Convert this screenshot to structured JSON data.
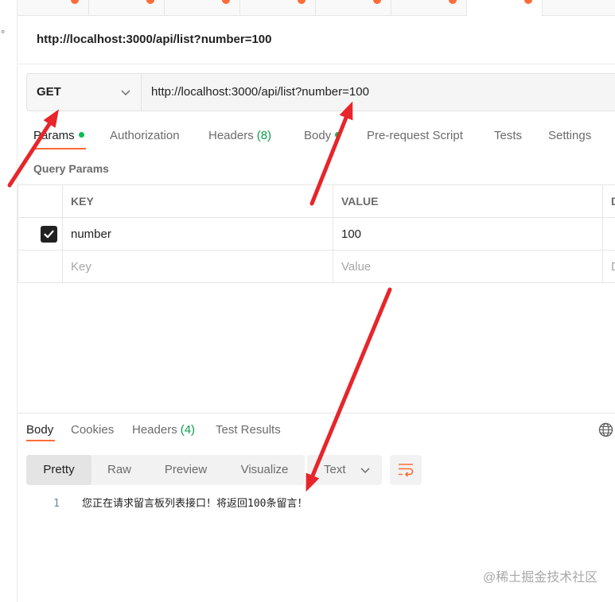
{
  "colors": {
    "accent": "#ff6c37",
    "success": "#0cbb52",
    "text": "#212121",
    "muted": "#6b6b6b",
    "placeholder": "#a6a6a6",
    "annotation_arrow": "#e8252a"
  },
  "sidebar": {
    "glyph": "°"
  },
  "open_tabs": [
    {
      "unsaved": true,
      "active": false
    },
    {
      "unsaved": true,
      "active": false
    },
    {
      "unsaved": true,
      "active": false
    },
    {
      "unsaved": true,
      "active": false
    },
    {
      "unsaved": true,
      "active": false
    },
    {
      "unsaved": true,
      "active": false
    },
    {
      "unsaved": true,
      "active": true
    }
  ],
  "request": {
    "title": "http://localhost:3000/api/list?number=100",
    "method": "GET",
    "url": "http://localhost:3000/api/list?number=100"
  },
  "request_tabs": [
    {
      "label": "Params",
      "active": true,
      "has_content_dot": true
    },
    {
      "label": "Authorization"
    },
    {
      "label": "Headers",
      "count": "(8)"
    },
    {
      "label": "Body",
      "has_content_dot": true
    },
    {
      "label": "Pre-request Script"
    },
    {
      "label": "Tests"
    },
    {
      "label": "Settings"
    }
  ],
  "query_params": {
    "title": "Query Params",
    "columns": {
      "key": "KEY",
      "value": "VALUE",
      "description": "D"
    },
    "rows": [
      {
        "enabled": true,
        "key": "number",
        "value": "100",
        "description": ""
      }
    ],
    "new_row": {
      "key": "Key",
      "value": "Value",
      "description": "D"
    }
  },
  "response": {
    "tabs": [
      {
        "label": "Body",
        "active": true
      },
      {
        "label": "Cookies"
      },
      {
        "label": "Headers",
        "count": "(4)"
      },
      {
        "label": "Test Results"
      }
    ],
    "view_modes": [
      {
        "label": "Pretty",
        "active": true
      },
      {
        "label": "Raw"
      },
      {
        "label": "Preview"
      },
      {
        "label": "Visualize"
      }
    ],
    "format": "Text",
    "lines": [
      {
        "number": "1",
        "text": "您正在请求留言板列表接口！将返回100条留言！"
      }
    ]
  },
  "icons": {
    "method_dropdown": "chevron-down-icon",
    "format_dropdown": "chevron-down-icon",
    "wrap": "wrap-lines-icon",
    "globe": "globe-icon",
    "checkbox": "checkbox-checked-icon"
  },
  "watermark": "@稀土掘金技术社区"
}
